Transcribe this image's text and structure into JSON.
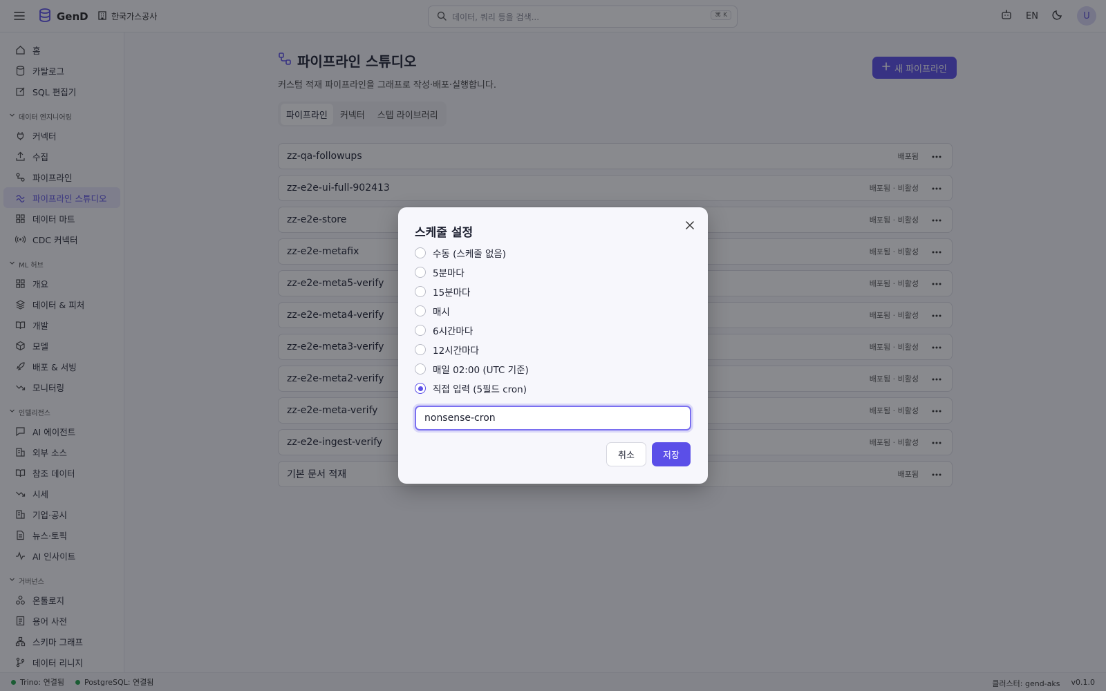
{
  "header": {
    "app_name": "GenD",
    "org_name": "한국가스공사",
    "search_placeholder": "데이터, 쿼리 등을 검색...",
    "search_shortcut": "⌘ K",
    "lang": "EN",
    "avatar_initial": "U"
  },
  "sidebar": {
    "top_items": [
      {
        "label": "홈",
        "icon": "home-icon"
      },
      {
        "label": "카탈로그",
        "icon": "database-icon"
      },
      {
        "label": "SQL 편집기",
        "icon": "edit-icon"
      }
    ],
    "groups": [
      {
        "title": "데이터 엔지니어링",
        "items": [
          {
            "label": "커넥터",
            "icon": "plug-icon"
          },
          {
            "label": "수집",
            "icon": "upload-icon"
          },
          {
            "label": "파이프라인",
            "icon": "route-icon"
          },
          {
            "label": "파이프라인 스튜디오",
            "icon": "studio-icon",
            "active": true
          },
          {
            "label": "데이터 마트",
            "icon": "grid-icon"
          },
          {
            "label": "CDC 커넥터",
            "icon": "radio-waves-icon"
          }
        ]
      },
      {
        "title": "ML 허브",
        "items": [
          {
            "label": "개요",
            "icon": "grid-icon"
          },
          {
            "label": "데이터 & 피처",
            "icon": "layers-icon"
          },
          {
            "label": "개발",
            "icon": "book-icon"
          },
          {
            "label": "모델",
            "icon": "cube-icon"
          },
          {
            "label": "배포 & 서빙",
            "icon": "rocket-icon"
          },
          {
            "label": "모니터링",
            "icon": "trend-icon"
          }
        ]
      },
      {
        "title": "인텔리전스",
        "items": [
          {
            "label": "AI 에이전트",
            "icon": "chat-icon"
          },
          {
            "label": "외부 소스",
            "icon": "building-icon"
          },
          {
            "label": "참조 데이터",
            "icon": "book-icon"
          },
          {
            "label": "시세",
            "icon": "trend-icon"
          },
          {
            "label": "기업·공시",
            "icon": "building-icon"
          },
          {
            "label": "뉴스·토픽",
            "icon": "document-icon"
          },
          {
            "label": "AI 인사이트",
            "icon": "pulse-icon"
          }
        ]
      },
      {
        "title": "거버넌스",
        "items": [
          {
            "label": "온톨로지",
            "icon": "nodes-icon"
          },
          {
            "label": "용어 사전",
            "icon": "document-icon"
          },
          {
            "label": "스키마 그래프",
            "icon": "network-icon"
          },
          {
            "label": "데이터 리니지",
            "icon": "branch-icon"
          }
        ]
      }
    ]
  },
  "page": {
    "title": "파이프라인 스튜디오",
    "subtitle": "커스텀 적재 파이프라인을 그래프로 작성·배포·실행합니다.",
    "new_button": "새 파이프라인",
    "tabs": [
      {
        "label": "파이프라인",
        "active": true
      },
      {
        "label": "커넥터"
      },
      {
        "label": "스텝 라이브러리"
      }
    ],
    "pipelines": [
      {
        "name": "zz-qa-followups",
        "status": "배포됨"
      },
      {
        "name": "zz-e2e-ui-full-902413",
        "status": "배포됨 · 비활성"
      },
      {
        "name": "zz-e2e-store",
        "status": "배포됨 · 비활성"
      },
      {
        "name": "zz-e2e-metafix",
        "status": "배포됨 · 비활성"
      },
      {
        "name": "zz-e2e-meta5-verify",
        "status": "배포됨 · 비활성"
      },
      {
        "name": "zz-e2e-meta4-verify",
        "status": "배포됨 · 비활성"
      },
      {
        "name": "zz-e2e-meta3-verify",
        "status": "배포됨 · 비활성"
      },
      {
        "name": "zz-e2e-meta2-verify",
        "status": "배포됨 · 비활성"
      },
      {
        "name": "zz-e2e-meta-verify",
        "status": "배포됨 · 비활성"
      },
      {
        "name": "zz-e2e-ingest-verify",
        "status": "배포됨 · 비활성"
      },
      {
        "name": "기본 문서 적재",
        "status": "배포됨"
      }
    ]
  },
  "modal": {
    "title": "스케줄 설정",
    "options": [
      {
        "label": "수동 (스케줄 없음)",
        "checked": false
      },
      {
        "label": "5분마다",
        "checked": false
      },
      {
        "label": "15분마다",
        "checked": false
      },
      {
        "label": "매시",
        "checked": false
      },
      {
        "label": "6시간마다",
        "checked": false
      },
      {
        "label": "12시간마다",
        "checked": false
      },
      {
        "label": "매일 02:00 (UTC 기준)",
        "checked": false
      },
      {
        "label": "직접 입력 (5필드 cron)",
        "checked": true
      }
    ],
    "cron_value": "nonsense-cron",
    "cancel_label": "취소",
    "save_label": "저장"
  },
  "footer": {
    "trino": "Trino: 연결됨",
    "postgres": "PostgreSQL: 연결됨",
    "cluster": "클러스터: gend-aks",
    "version": "v0.1.0"
  },
  "colors": {
    "accent": "#5b4fe8",
    "status_ok": "#22a34a"
  }
}
